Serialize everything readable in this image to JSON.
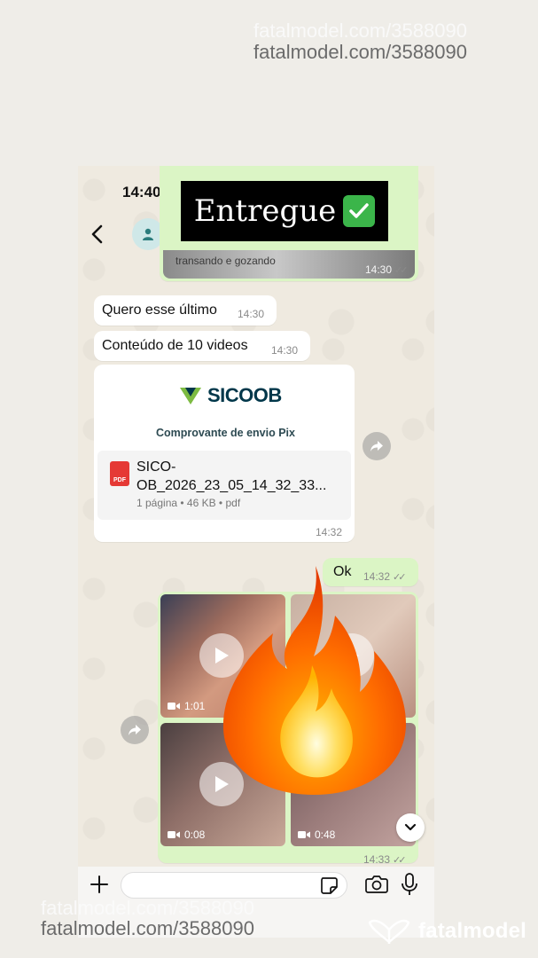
{
  "watermarks": {
    "top": "fatalmodel.com/3588090",
    "bottom": "fatalmodel.com/3588090"
  },
  "brand": {
    "name": "fatalmodel"
  },
  "status_bar": {
    "time": "14:40"
  },
  "overlay": {
    "label": "Entregue"
  },
  "messages": {
    "top_media": {
      "caption": "transando e gozando",
      "time": "14:30"
    },
    "m1": {
      "text": "Quero esse último",
      "time": "14:30"
    },
    "m2": {
      "text": "Conteúdo de 10 videos",
      "time": "14:30"
    },
    "doc": {
      "brand": "SICOOB",
      "subtitle": "Comprovante de envio Pix",
      "icon_label": "PDF",
      "filename": "SICO-OB_2026_23_05_14_32_33...",
      "meta": "1 página • 46 KB • pdf",
      "time": "14:32"
    },
    "m3": {
      "text": "Ok",
      "time": "14:32"
    },
    "album": {
      "videos": [
        {
          "duration": "1:01"
        },
        {
          "duration": ""
        },
        {
          "duration": "0:08"
        },
        {
          "duration": "0:48"
        }
      ],
      "time": "14:33"
    }
  },
  "input": {
    "placeholder": ""
  },
  "colors": {
    "outgoing_bubble": "#dbf5c5",
    "incoming_bubble": "#ffffff",
    "chat_background": "#efeae0",
    "check_green": "#3bb54a",
    "pdf_red": "#e53935",
    "sicoob_green": "#7dbb42",
    "sicoob_blue": "#00374a"
  },
  "icons": [
    "back-arrow-icon",
    "contact-avatar-icon",
    "phone-icon",
    "forward-icon",
    "play-icon",
    "video-camera-icon",
    "chevron-down-icon",
    "plus-icon",
    "sticker-icon",
    "camera-icon",
    "microphone-icon",
    "fire-emoji-icon",
    "check-mark-icon",
    "pdf-icon"
  ]
}
